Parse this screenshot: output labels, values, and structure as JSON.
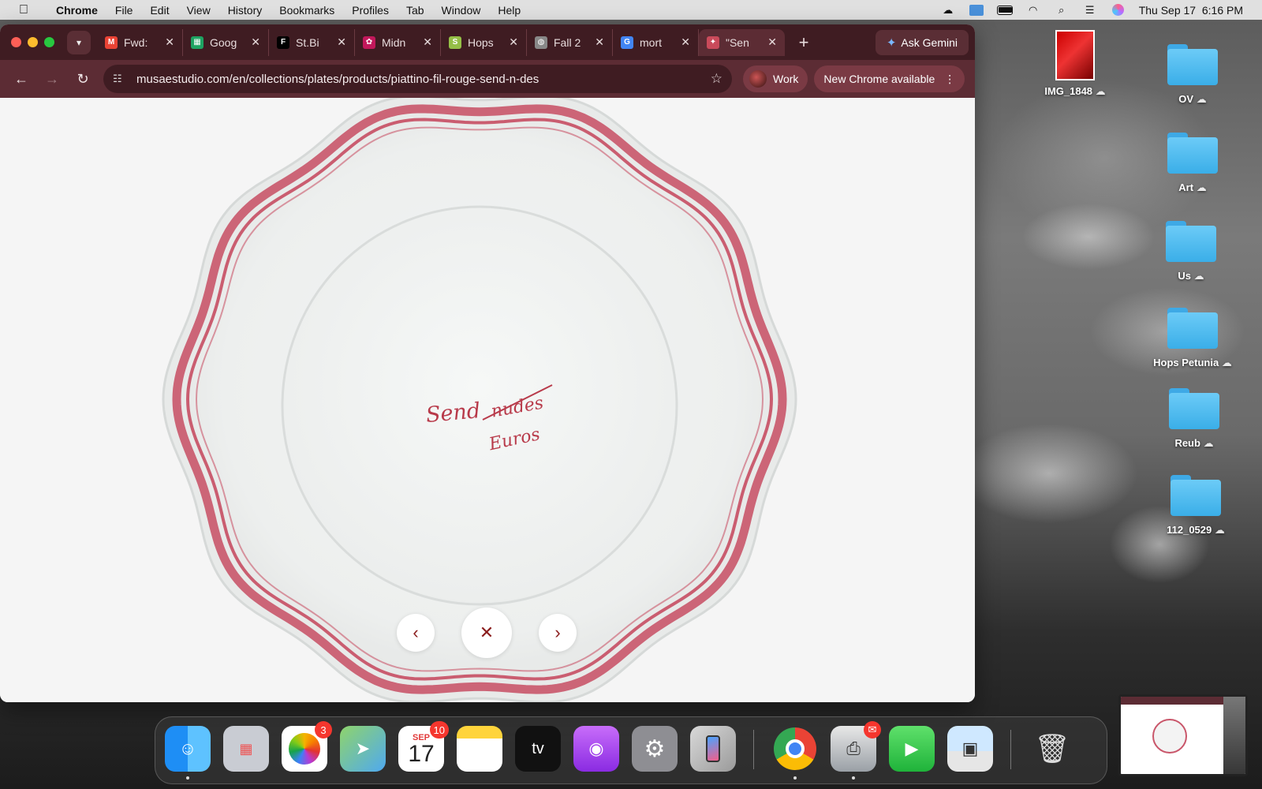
{
  "menubar": {
    "app": "Chrome",
    "items": [
      "File",
      "Edit",
      "View",
      "History",
      "Bookmarks",
      "Profiles",
      "Tab",
      "Window",
      "Help"
    ],
    "clock": "Thu Sep 17  6:16 PM"
  },
  "tabs": [
    {
      "label": "Fwd:",
      "icon": "gmail-icon",
      "color": "#ea4335",
      "glyph": "M"
    },
    {
      "label": "Goog",
      "icon": "google-sheets-icon",
      "color": "#1ea362",
      "glyph": "▦"
    },
    {
      "label": "St.Bi",
      "icon": "f-logo-icon",
      "color": "#000000",
      "glyph": "F"
    },
    {
      "label": "Midn",
      "icon": "flower-icon",
      "color": "#c2185b",
      "glyph": "✿"
    },
    {
      "label": "Hops",
      "icon": "shopify-icon",
      "color": "#95bf47",
      "glyph": "S"
    },
    {
      "label": "Fall 2",
      "icon": "globe-icon",
      "color": "#888888",
      "glyph": "◍"
    },
    {
      "label": "mort",
      "icon": "google-icon",
      "color": "#4285f4",
      "glyph": "G"
    },
    {
      "label": "\"Sen",
      "icon": "plate-favicon-icon",
      "color": "#c94a5a",
      "glyph": "✦",
      "active": true
    }
  ],
  "gemini_label": "Ask Gemini",
  "address_bar": {
    "url": "musaestudio.com/en/collections/plates/products/piattino-fil-rouge-send-n-des"
  },
  "profile_label": "Work",
  "update_label": "New Chrome available",
  "plate": {
    "line1": "Send",
    "struck": "nudes",
    "line2": "Euros",
    "rim_color": "#c9566a",
    "ink_color": "#b83a4a"
  },
  "desktop_icons": [
    {
      "label": "IMG_1848",
      "kind": "image"
    },
    {
      "label": "OV",
      "kind": "folder"
    },
    {
      "label": "Art",
      "kind": "folder"
    },
    {
      "label": "Us",
      "kind": "folder"
    },
    {
      "label": "Hops Petunia",
      "kind": "folder"
    },
    {
      "label": "Reub",
      "kind": "folder"
    },
    {
      "label": "112_0529",
      "kind": "folder"
    }
  ],
  "dock": {
    "photos_badge": "3",
    "calendar_month": "SEP",
    "calendar_day": "17",
    "calendar_badge": "10",
    "appletv_label": "tv"
  }
}
